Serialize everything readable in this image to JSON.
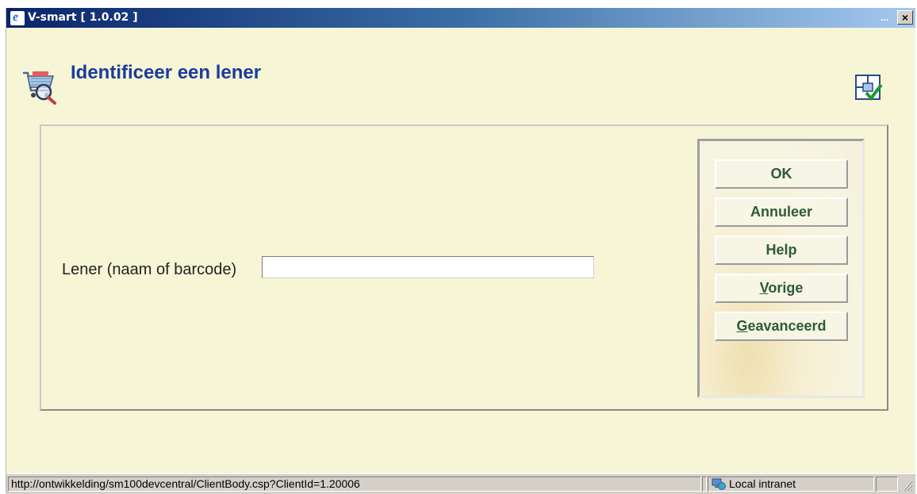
{
  "window": {
    "title": "V-smart [ 1.0.02 ]",
    "title_dots": "...",
    "close_label": "×"
  },
  "page": {
    "title": "Identificeer een lener"
  },
  "form": {
    "field_label": "Lener (naam of barcode)",
    "field_value": "",
    "field_placeholder": ""
  },
  "buttons": {
    "ok": "OK",
    "cancel": "Annuleer",
    "help": "Help",
    "previous_first": "V",
    "previous_rest": "orige",
    "advanced_first": "G",
    "advanced_rest": "eavanceerd"
  },
  "statusbar": {
    "url": "http://ontwikkelding/sm100devcentral/ClientBody.csp?ClientId=1.20006",
    "zone": "Local intranet"
  },
  "icons": {
    "app": "ie-icon",
    "page": "cart-search-icon",
    "form": "form-check-icon",
    "zone": "intranet-icon",
    "grip": "resize-grip-icon"
  },
  "colors": {
    "background": "#f6f5d6",
    "title_text": "#1b3c9a",
    "button_text": "#2d5a3a",
    "titlebar_start": "#0a246a",
    "titlebar_end": "#a6caf0"
  }
}
